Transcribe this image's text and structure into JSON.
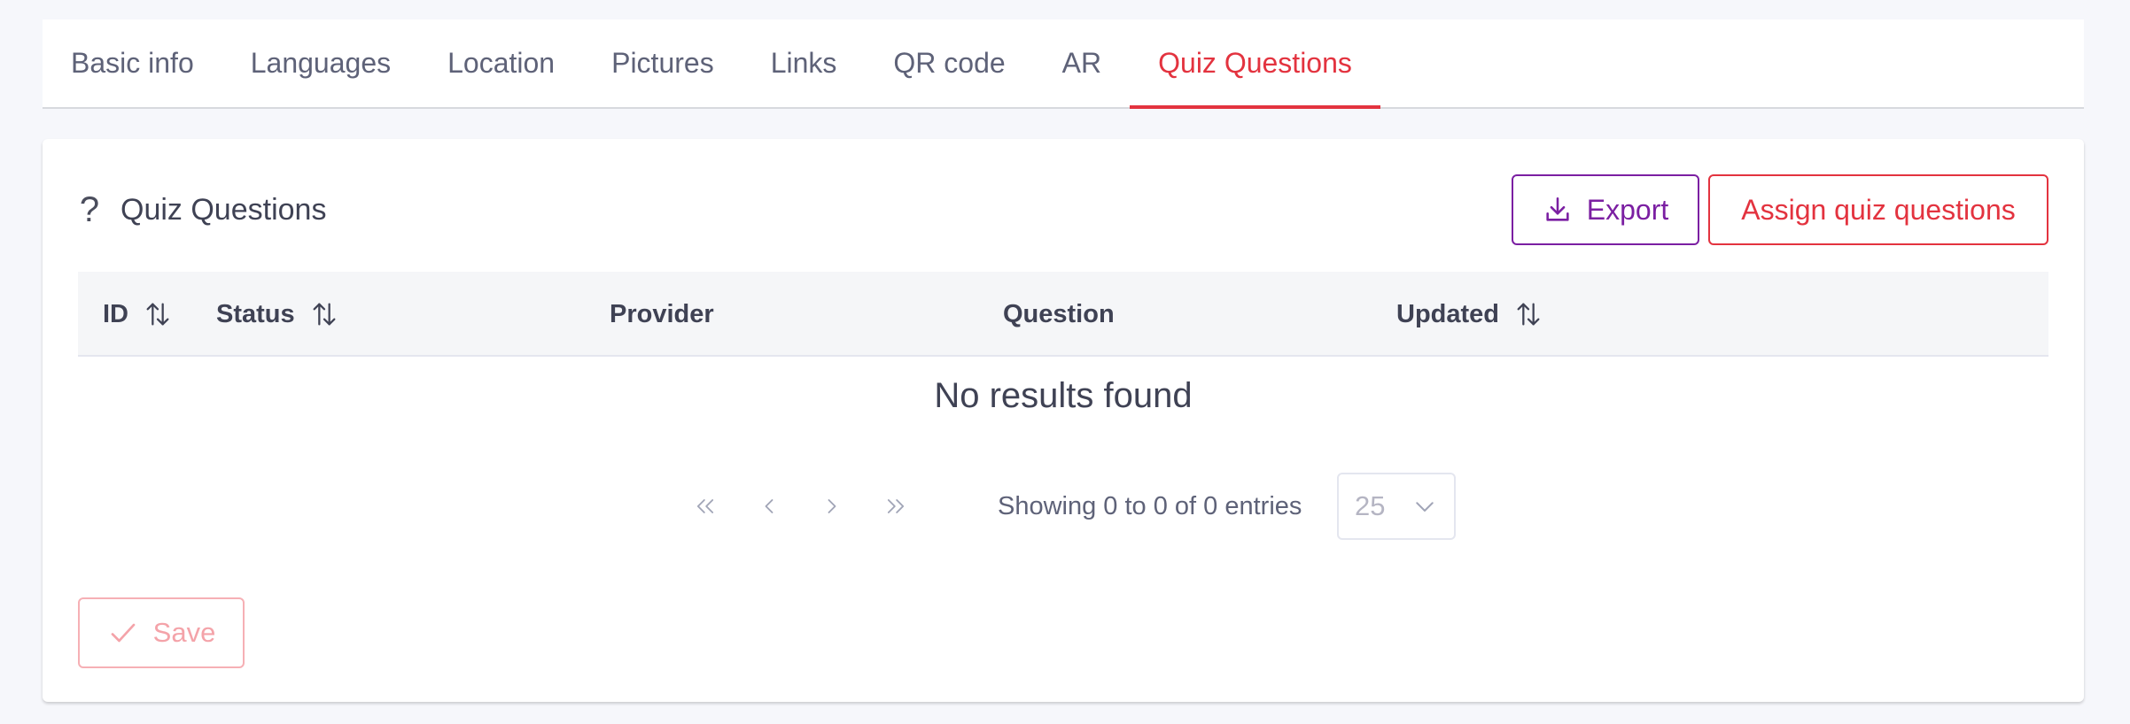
{
  "tabs": [
    {
      "label": "Basic info",
      "active": false
    },
    {
      "label": "Languages",
      "active": false
    },
    {
      "label": "Location",
      "active": false
    },
    {
      "label": "Pictures",
      "active": false
    },
    {
      "label": "Links",
      "active": false
    },
    {
      "label": "QR code",
      "active": false
    },
    {
      "label": "AR",
      "active": false
    },
    {
      "label": "Quiz Questions",
      "active": true
    }
  ],
  "card": {
    "title": "Quiz Questions",
    "title_icon": "question-mark-icon",
    "export_label": "Export",
    "export_icon": "download-icon",
    "assign_label": "Assign quiz questions"
  },
  "table": {
    "columns": [
      {
        "label": "ID",
        "sortable": true
      },
      {
        "label": "Status",
        "sortable": true
      },
      {
        "label": "Provider",
        "sortable": false
      },
      {
        "label": "Question",
        "sortable": false
      },
      {
        "label": "Updated",
        "sortable": true
      }
    ],
    "empty_text": "No results found"
  },
  "pagination": {
    "entries_text": "Showing 0 to 0 of 0 entries",
    "page_size": "25"
  },
  "footer": {
    "save_label": "Save",
    "save_icon": "check-icon"
  },
  "colors": {
    "accent_red": "#e3333f",
    "accent_purple": "#7b1fa2",
    "text": "#3f4254",
    "muted": "#5e6278"
  }
}
